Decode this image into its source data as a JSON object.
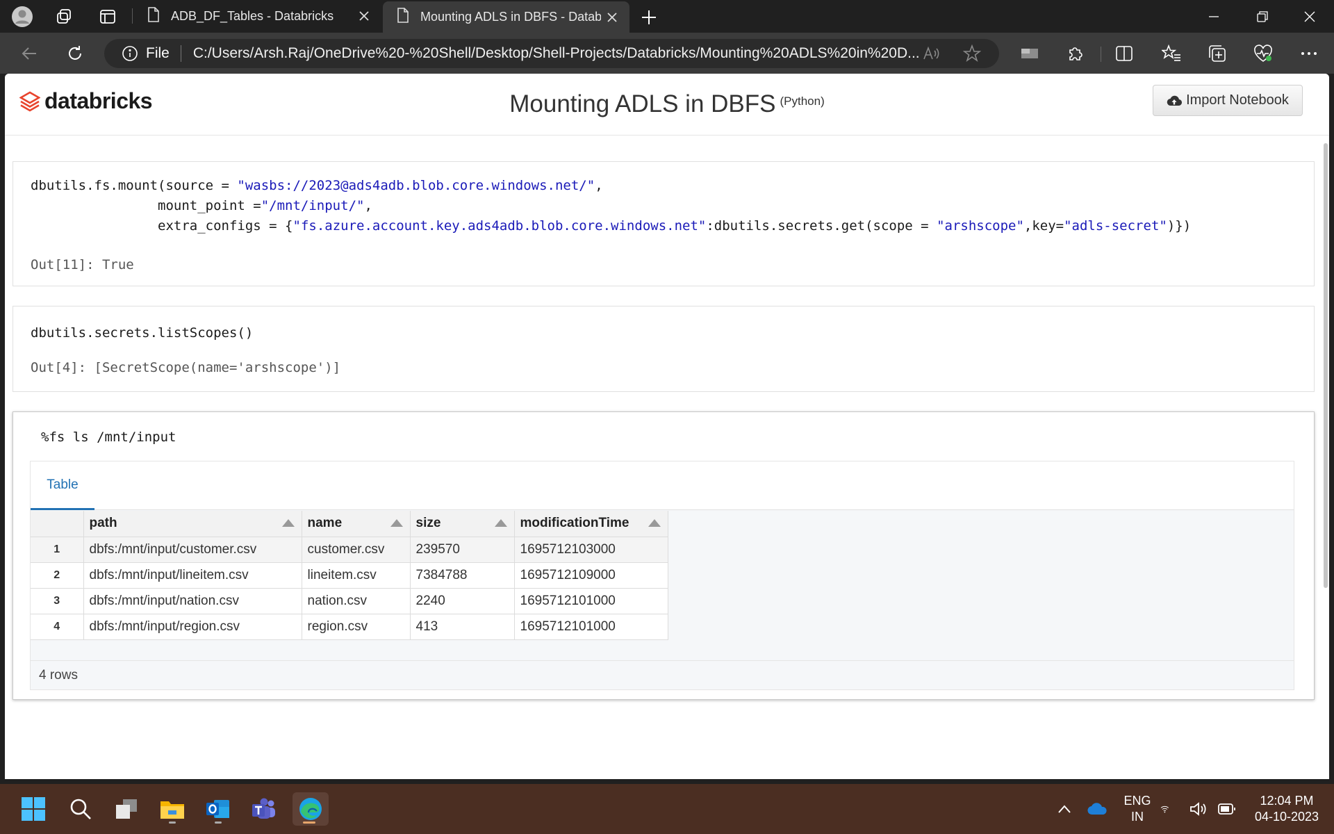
{
  "browser": {
    "tabs": [
      {
        "title": "ADB_DF_Tables - Databricks",
        "active": false
      },
      {
        "title": "Mounting ADLS in DBFS - Databr",
        "active": true
      }
    ],
    "address": {
      "scheme_label": "File",
      "url": "C:/Users/Arsh.Raj/OneDrive%20-%20Shell/Desktop/Shell-Projects/Databricks/Mounting%20ADLS%20in%20D..."
    }
  },
  "header": {
    "logo_text": "databricks",
    "notebook_title": "Mounting ADLS in DBFS",
    "language": "(Python)",
    "import_label": "Import Notebook"
  },
  "cells": [
    {
      "code_line1_a": "dbutils.fs.mount(source = ",
      "code_line1_s": "\"wasbs://2023@ads4adb.blob.core.windows.net/\"",
      "code_line1_b": ",",
      "code_line2_a": "                mount_point =",
      "code_line2_s": "\"/mnt/input/\"",
      "code_line2_b": ",",
      "code_line3_a": "                extra_configs = {",
      "code_line3_s1": "\"fs.azure.account.key.ads4adb.blob.core.windows.net\"",
      "code_line3_b": ":dbutils.secrets.get(scope = ",
      "code_line3_s2": "\"arshscope\"",
      "code_line3_c": ",key=",
      "code_line3_s3": "\"adls-secret\"",
      "code_line3_d": ")})",
      "output": "Out[11]: True"
    },
    {
      "code": "dbutils.secrets.listScopes()",
      "output": "Out[4]: [SecretScope(name='arshscope')]"
    },
    {
      "code": "%fs ls /mnt/input",
      "tab_label": "Table",
      "columns": [
        "path",
        "name",
        "size",
        "modificationTime"
      ],
      "rows": [
        {
          "idx": "1",
          "path": "dbfs:/mnt/input/customer.csv",
          "name": "customer.csv",
          "size": "239570",
          "modificationTime": "1695712103000"
        },
        {
          "idx": "2",
          "path": "dbfs:/mnt/input/lineitem.csv",
          "name": "lineitem.csv",
          "size": "7384788",
          "modificationTime": "1695712109000"
        },
        {
          "idx": "3",
          "path": "dbfs:/mnt/input/nation.csv",
          "name": "nation.csv",
          "size": "2240",
          "modificationTime": "1695712101000"
        },
        {
          "idx": "4",
          "path": "dbfs:/mnt/input/region.csv",
          "name": "region.csv",
          "size": "413",
          "modificationTime": "1695712101000"
        }
      ],
      "footer": "4 rows"
    }
  ],
  "taskbar": {
    "lang_line1": "ENG",
    "lang_line2": "IN",
    "time": "12:04 PM",
    "date": "04-10-2023"
  },
  "colors": {
    "accent": "#2272b4",
    "string": "#1a1ab8",
    "logo": "#e8442d"
  }
}
